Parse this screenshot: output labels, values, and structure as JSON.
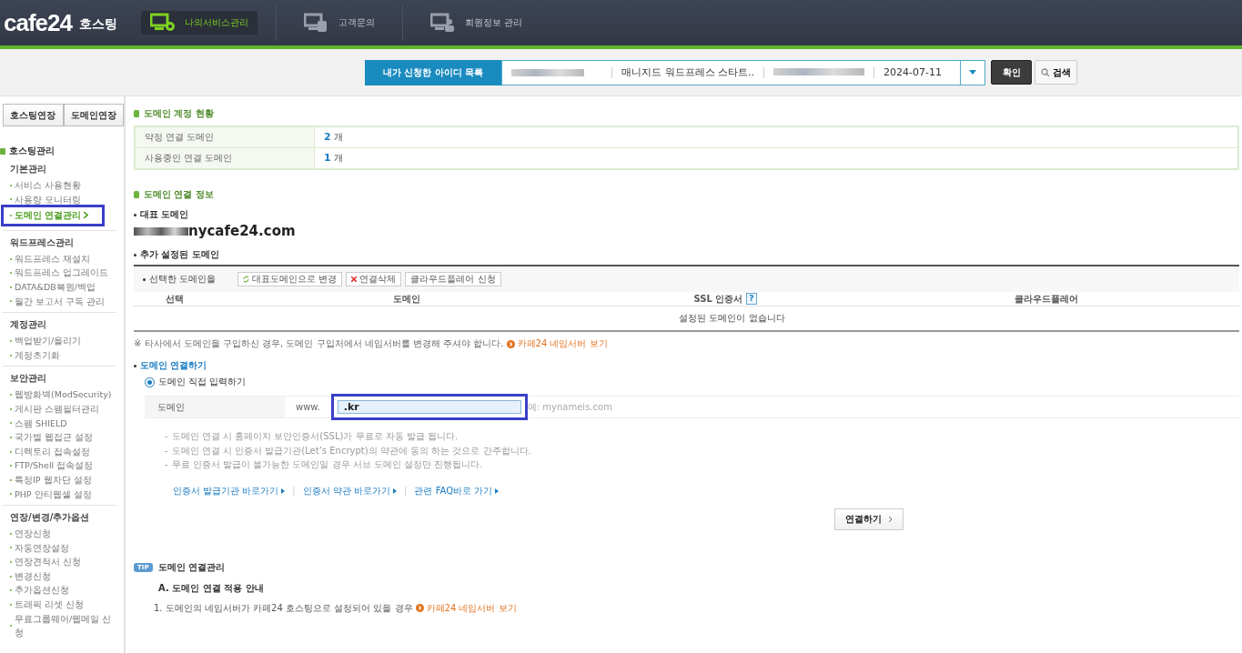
{
  "header": {
    "logo": "cafe24",
    "logo_suffix": "호스팅",
    "nav": [
      {
        "label": "나의서비스관리",
        "selected": true,
        "kind": "gear"
      },
      {
        "label": "고객문의",
        "selected": false,
        "kind": "phone"
      },
      {
        "label": "회원정보 관리",
        "selected": false,
        "kind": "person"
      }
    ]
  },
  "id_bar": {
    "label": "내가 신청한 아이디 목록",
    "product": "매니지드 워드프레스 스타트..",
    "date": "2024-07-11",
    "confirm": "확인",
    "search": "검색"
  },
  "sidebar": {
    "buttons": [
      "호스팅연장",
      "도메인연장"
    ],
    "title": "호스팅관리",
    "groups": [
      {
        "heading": "기본관리",
        "items": [
          {
            "label": "서비스 사용현황",
            "selected": false
          },
          {
            "label": "사용량 모니터링",
            "selected": false
          },
          {
            "label": "도메인 연결관리",
            "selected": true
          }
        ]
      },
      {
        "heading": "워드프레스관리",
        "items": [
          {
            "label": "워드프레스 재설치",
            "selected": false
          },
          {
            "label": "워드프레스 업그레이드",
            "selected": false
          },
          {
            "label": "DATA&DB복원/백업",
            "selected": false
          },
          {
            "label": "월간 보고서 구독 관리",
            "selected": false
          }
        ]
      },
      {
        "heading": "계정관리",
        "items": [
          {
            "label": "백업받기/올리기",
            "selected": false
          },
          {
            "label": "계정초기화",
            "selected": false
          }
        ]
      },
      {
        "heading": "보안관리",
        "items": [
          {
            "label": "웹방화벽(ModSecurity)",
            "selected": false
          },
          {
            "label": "게시판 스팸필터관리",
            "selected": false
          },
          {
            "label": "스팸 SHIELD",
            "selected": false
          },
          {
            "label": "국가별 웹접근 설정",
            "selected": false
          },
          {
            "label": "디렉토리 접속설정",
            "selected": false
          },
          {
            "label": "FTP/Shell 접속설정",
            "selected": false
          },
          {
            "label": "특정IP 웹차단 설정",
            "selected": false
          },
          {
            "label": "PHP 안티웹셸 설정",
            "selected": false
          }
        ]
      },
      {
        "heading": "연장/변경/추가옵션",
        "items": [
          {
            "label": "연장신청",
            "selected": false
          },
          {
            "label": "자동연장설정",
            "selected": false
          },
          {
            "label": "연장견적서 신청",
            "selected": false
          },
          {
            "label": "변경신청",
            "selected": false
          },
          {
            "label": "추가옵션신청",
            "selected": false
          },
          {
            "label": "트래픽 리셋 신청",
            "selected": false
          },
          {
            "label": "무료그룹웨어/웹메일 신청",
            "selected": false
          }
        ]
      }
    ]
  },
  "status": {
    "title": "도메인 계정 현황",
    "rows": [
      {
        "label": "약정 연결 도메인",
        "count": "2",
        "unit": "개"
      },
      {
        "label": "사용중인 연결 도메인",
        "count": "1",
        "unit": "개"
      }
    ]
  },
  "info": {
    "title": "도메인 연결 정보",
    "primary_label": "대표 도메인",
    "primary_domain": "nycafe24.com",
    "extra_label": "추가 설정된 도메인",
    "actions_label": "선택한 도메인을",
    "actions": [
      {
        "label": "대표도메인으로 변경",
        "kind": "swap"
      },
      {
        "label": "연결삭제",
        "kind": "delete"
      },
      {
        "label": "클라우드플레어 신청",
        "kind": "plain"
      }
    ],
    "columns": [
      "선택",
      "도메인",
      "SSL 인증서",
      "클라우드플레어"
    ],
    "help": "?",
    "empty": "설정된 도메인이 없습니다",
    "note": "※ 타사에서 도메인을 구입하신 경우, 도메인 구입처에서 네임서버를 변경해 주셔야 합니다.",
    "note_link": "카페24 네임서버 보기"
  },
  "connect": {
    "title": "도메인 연결하기",
    "radio": {
      "label": "도메인 직접 입력하기",
      "selected": true
    },
    "field_label": "도메인",
    "prefix": "www.",
    "value": ".kr",
    "highlighted": true,
    "example": "예: mynameis.com",
    "note_mark": "-",
    "notes": [
      "도메인 연결 시 홈페이지 보안인증서(SSL)가 무료로 자동 발급 됩니다.",
      "도메인 연결 시 인증서 발급기관(Let’s Encrypt)의 약관에 동의 하는 것으로 간주합니다.",
      "무료 인증서 발급이 불가능한 도메인일 경우 서브 도메인 설정만 진행됩니다."
    ],
    "links": [
      "인증서 발급기관 바로가기",
      "인증서 약관 바로가기",
      "관련 FAQ바로 가기"
    ],
    "link_separator": "|",
    "button": "연결하기"
  },
  "tip": {
    "badge": "TIP",
    "title": "도메인 연결관리",
    "subtitle": "A. 도메인 연결 적용 안내",
    "line": "1. 도메인의 네임서버가 카페24 호스팅으로 설정되어 있을 경우",
    "link": "카페24 네임서버 보기"
  }
}
